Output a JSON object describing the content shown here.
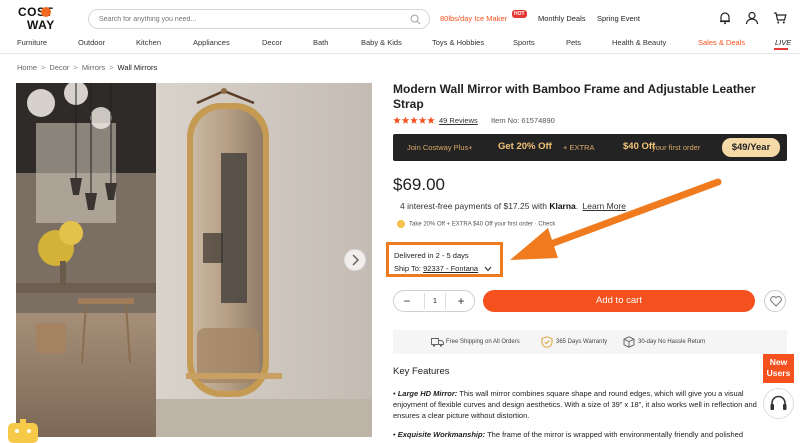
{
  "header": {
    "logo": {
      "line1": "COST",
      "line2": "WAY"
    },
    "search_placeholder": "Search for anything you need...",
    "promos": [
      {
        "label": "80lbs/day Ice Maker",
        "badge": "HOT"
      },
      {
        "label": "Monthly Deals"
      },
      {
        "label": "Spring Event"
      }
    ],
    "icons": [
      "notification-icon",
      "user-icon",
      "cart-icon"
    ]
  },
  "nav": {
    "items": [
      "Furniture",
      "Outdoor",
      "Kitchen",
      "Appliances",
      "Decor",
      "Bath",
      "Baby & Kids",
      "Toys & Hobbies",
      "Sports",
      "Pets",
      "Health & Beauty",
      "Sales & Deals",
      "LIVE"
    ]
  },
  "breadcrumb": [
    "Home",
    "Decor",
    "Mirrors",
    "Wall Mirrors"
  ],
  "product": {
    "title": "Modern Wall Mirror with Bamboo Frame and Adjustable Leather Strap",
    "rating": 5,
    "reviews": "49 Reviews",
    "item_no": "Item No: 61574890",
    "price": "$69.00",
    "klarna": {
      "prefix": "4 interest-free payments of $17.25 with",
      "brand": "Klarna",
      "suffix": ".",
      "link": "Learn More"
    },
    "coupon_text": "Take 20% Off + EXTRA $40 Off your first order · Check"
  },
  "plus_banner": {
    "part1": "Join Costway Plus+",
    "part2": "Get 20% Off",
    "part3": "+ EXTRA",
    "part4": "$40 Off",
    "part5": "your first order",
    "price": "$49/Year"
  },
  "delivery": {
    "eta": "Delivered in 2 - 5 days",
    "ship_label": "Ship To:",
    "zip": "92337 - Fontana"
  },
  "purchase": {
    "quantity": "1",
    "minus": "−",
    "plus": "+",
    "add_to_cart": "Add to cart"
  },
  "benefits": [
    {
      "icon": "truck-icon",
      "label": "Free Shipping on All Orders"
    },
    {
      "icon": "shield-icon",
      "label": "365 Days Warranty"
    },
    {
      "icon": "box-return-icon",
      "label": "30-day No Hassle Return"
    }
  ],
  "side": {
    "new_users": "New Users"
  },
  "features": {
    "heading": "Key Features",
    "items": [
      {
        "title": "Large HD Mirror:",
        "text": "This wall mirror combines square shape and round edges, which will give you a visual enjoyment of flexible curves and design aesthetics. With a size of 39\" x 18\", it also works well in reflection and ensures a clear picture without distortion."
      },
      {
        "title": "Exquisite Workmanship:",
        "text": "The frame of the mirror is wrapped with environmentally friendly and polished"
      }
    ]
  },
  "colors": {
    "accent": "#f4511e",
    "highlight_box": "#f07b1f",
    "banner_bg": "#232323",
    "banner_gold": "#f2c27a"
  }
}
